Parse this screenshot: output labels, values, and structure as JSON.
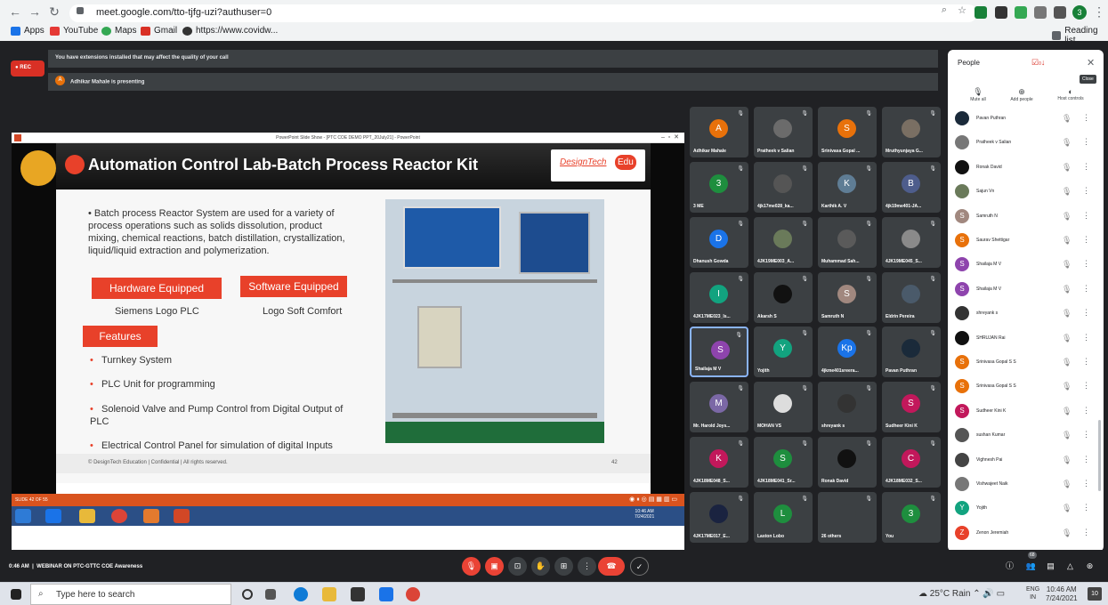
{
  "browser": {
    "url": "meet.google.com/tto-tjfg-uzi?authuser=0",
    "profile_initial": "3",
    "bookmarks": [
      "Apps",
      "YouTube",
      "Maps",
      "Gmail",
      "https://www.covidw..."
    ],
    "reading_list": "Reading list"
  },
  "meet": {
    "rec_label": "REC",
    "banner_extensions": "You have extensions installed that may affect the quality of your call",
    "banner_presenting": "Adhikar Mahale is presenting",
    "presenter_initial": "A",
    "meeting_time": "0:46 AM",
    "meeting_title": "WEBINAR ON PTC-GTTC COE Awareness"
  },
  "presentation": {
    "window_title": "PowerPoint Slide Show - [PTC COE DEMO PPT_20July21] - PowerPoint",
    "slide_title": "Automation Control Lab-Batch Process Reactor Kit",
    "logo_text": "DesignTech",
    "logo_badge": "Edu",
    "intro": "Batch process Reactor System are used for a variety of process operations such as solids dissolution, product mixing, chemical reactions, batch distillation, crystallization, liquid/liquid extraction and polymerization.",
    "hardware_label": "Hardware Equipped",
    "hardware_value": "Siemens Logo PLC",
    "software_label": "Software Equipped",
    "software_value": "Logo Soft Comfort",
    "features_label": "Features",
    "features": [
      "Turnkey System",
      "PLC Unit for programming",
      "Solenoid Valve and Pump Control from Digital Output of PLC",
      "Electrical Control Panel for simulation of digital Inputs"
    ],
    "footer": "© DesignTech Education | Confidential | All rights reserved.",
    "page_number": "42",
    "slide_counter": "SLIDE 42 OF 55",
    "inner_clock": "10:46 AM",
    "inner_date": "7/24/2021"
  },
  "tiles": [
    {
      "name": "Adhikar Mahale",
      "initial": "A",
      "color": "#e8710a"
    },
    {
      "name": "Pratheek v Salian",
      "initial": "",
      "color": "#6b6b6b"
    },
    {
      "name": "Srinivasa Gopal ...",
      "initial": "S",
      "color": "#e8710a"
    },
    {
      "name": "Mruthyunjaya G...",
      "initial": "",
      "color": "#7a6f63"
    },
    {
      "name": "3 ME",
      "initial": "3",
      "color": "#1e8e3e"
    },
    {
      "name": "4jk17me028_ka...",
      "initial": "",
      "color": "#555"
    },
    {
      "name": "Karthik A. V",
      "initial": "K",
      "color": "#5f7d95"
    },
    {
      "name": "4jk19me401-JA...",
      "initial": "B",
      "color": "#4e5d8c"
    },
    {
      "name": "Dhanush Gowda",
      "initial": "D",
      "color": "#1a73e8"
    },
    {
      "name": "4JK19ME003_A...",
      "initial": "",
      "color": "#6a7a5a"
    },
    {
      "name": "Muhammad Sah...",
      "initial": "",
      "color": "#5a5a5a"
    },
    {
      "name": "4JK19ME045_S...",
      "initial": "",
      "color": "#8a8a8a"
    },
    {
      "name": "4JK17ME023_Is...",
      "initial": "I",
      "color": "#12a37f"
    },
    {
      "name": "Akarsh S",
      "initial": "",
      "color": "#111"
    },
    {
      "name": "Samruth N",
      "initial": "S",
      "color": "#a1887f"
    },
    {
      "name": "Eldrin Pereira",
      "initial": "",
      "color": "#4a5a6a"
    },
    {
      "name": "Shailaja M V",
      "initial": "S",
      "color": "#8e44ad"
    },
    {
      "name": "Yojith",
      "initial": "Y",
      "color": "#12a37f"
    },
    {
      "name": "4jkme401sreera...",
      "initial": "Kp",
      "color": "#1a73e8"
    },
    {
      "name": "Pavan Puthran",
      "initial": "",
      "color": "#1a2a3a"
    },
    {
      "name": "Mr. Harold Joys...",
      "initial": "M",
      "color": "#7b68a6"
    },
    {
      "name": "MOHAN VS",
      "initial": "",
      "color": "#ddd"
    },
    {
      "name": "shreyank s",
      "initial": "",
      "color": "#333"
    },
    {
      "name": "Sudheer Kini K",
      "initial": "S",
      "color": "#c2185b"
    },
    {
      "name": "4JK18ME048_S...",
      "initial": "K",
      "color": "#c2185b"
    },
    {
      "name": "4JK18ME041_Sr...",
      "initial": "S",
      "color": "#1e8e3e"
    },
    {
      "name": "Ronak David",
      "initial": "",
      "color": "#111"
    },
    {
      "name": "4JK18ME032_S...",
      "initial": "C",
      "color": "#c2185b"
    },
    {
      "name": "4JK17ME017_E...",
      "initial": "",
      "color": "#1a2340"
    },
    {
      "name": "Laston Lobo",
      "initial": "L",
      "color": "#1e8e3e"
    },
    {
      "name": "26 others",
      "initial": "",
      "color": "#3c4043"
    },
    {
      "name": "You",
      "initial": "3",
      "color": "#1e8e3e"
    }
  ],
  "people_panel": {
    "title": "People",
    "count": "0",
    "close_tooltip": "Close",
    "actions": [
      "Mute all",
      "Add people",
      "Host controls"
    ],
    "list": [
      {
        "name": "Pavan Puthran",
        "initial": "",
        "color": "#1a2a3a"
      },
      {
        "name": "Pratheek v Salian",
        "initial": "",
        "color": "#777"
      },
      {
        "name": "Ronak David",
        "initial": "",
        "color": "#111"
      },
      {
        "name": "Sajun Vn",
        "initial": "",
        "color": "#6a7a5a"
      },
      {
        "name": "Samruth N",
        "initial": "S",
        "color": "#a1887f"
      },
      {
        "name": "Saurav Shettigar",
        "initial": "S",
        "color": "#e8710a"
      },
      {
        "name": "Shailaja M V",
        "initial": "S",
        "color": "#8e44ad"
      },
      {
        "name": "Shailaja M V",
        "initial": "S",
        "color": "#8e44ad"
      },
      {
        "name": "shreyank s",
        "initial": "",
        "color": "#333"
      },
      {
        "name": "SHRUJAN Rai",
        "initial": "",
        "color": "#111"
      },
      {
        "name": "Srinivasa Gopal S S",
        "initial": "S",
        "color": "#e8710a"
      },
      {
        "name": "Srinivasa Gopal S S",
        "initial": "S",
        "color": "#e8710a"
      },
      {
        "name": "Sudheer Kini K",
        "initial": "S",
        "color": "#c2185b"
      },
      {
        "name": "sushan Kumar",
        "initial": "",
        "color": "#555"
      },
      {
        "name": "Vighnesh Pai",
        "initial": "",
        "color": "#444"
      },
      {
        "name": "Vishwajeet Naik",
        "initial": "",
        "color": "#777"
      },
      {
        "name": "Yojith",
        "initial": "Y",
        "color": "#12a37f"
      },
      {
        "name": "Zenon Jeremiah",
        "initial": "Z",
        "color": "#e8412a"
      }
    ]
  },
  "bottom_right": {
    "people_badge": "68"
  },
  "taskbar": {
    "search_placeholder": "Type here to search",
    "weather": "25°C Rain",
    "lang": "ENG",
    "region": "IN",
    "time": "10:46 AM",
    "date": "7/24/2021",
    "notifications": "10"
  }
}
